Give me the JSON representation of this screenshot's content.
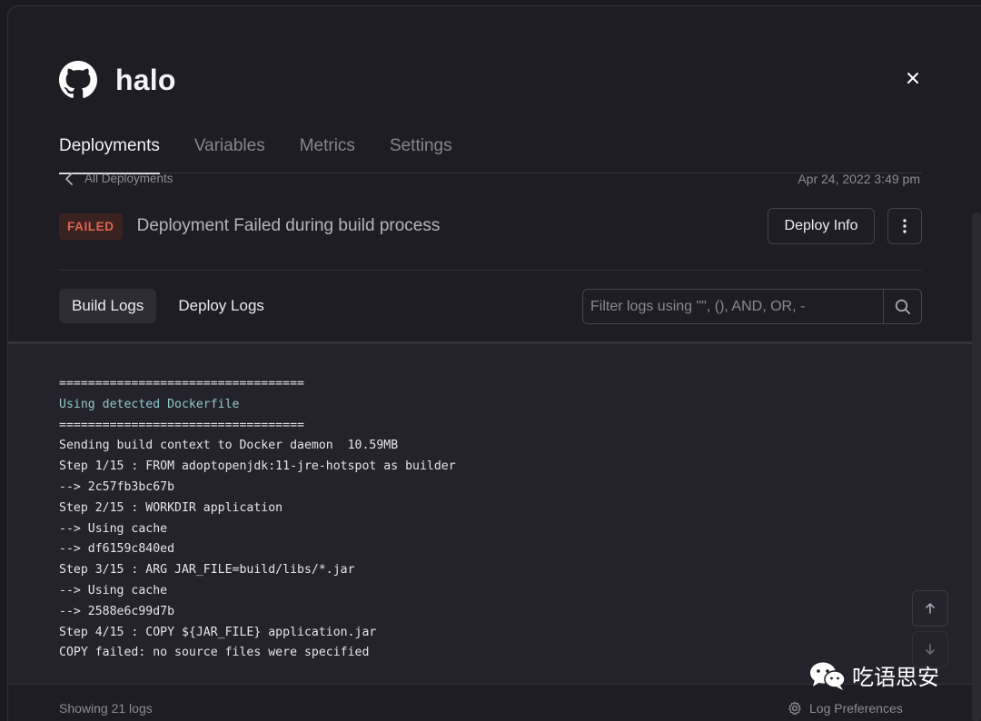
{
  "header": {
    "title": "halo",
    "icon": "github-icon"
  },
  "tabs": [
    {
      "label": "Deployments",
      "active": true
    },
    {
      "label": "Variables",
      "active": false
    },
    {
      "label": "Metrics",
      "active": false
    },
    {
      "label": "Settings",
      "active": false
    }
  ],
  "breadcrumb": {
    "label": "All Deployments"
  },
  "deployment": {
    "date": "Apr 24, 2022 3:49 pm",
    "status": "FAILED",
    "status_color": "#e0654f",
    "message": "Deployment Failed during build process",
    "deploy_info_label": "Deploy Info"
  },
  "log_tabs": [
    {
      "label": "Build Logs",
      "active": true
    },
    {
      "label": "Deploy Logs",
      "active": false
    }
  ],
  "filter": {
    "placeholder": "Filter logs using \"\", (), AND, OR, -"
  },
  "logs": [
    {
      "text": "==================================",
      "highlight": false
    },
    {
      "text": "Using detected Dockerfile",
      "highlight": true
    },
    {
      "text": "==================================",
      "highlight": false
    },
    {
      "text": "Sending build context to Docker daemon  10.59MB",
      "highlight": false
    },
    {
      "text": "Step 1/15 : FROM adoptopenjdk:11-jre-hotspot as builder",
      "highlight": false
    },
    {
      "text": "--> 2c57fb3bc67b",
      "highlight": false
    },
    {
      "text": "Step 2/15 : WORKDIR application",
      "highlight": false
    },
    {
      "text": "--> Using cache",
      "highlight": false
    },
    {
      "text": "--> df6159c840ed",
      "highlight": false
    },
    {
      "text": "Step 3/15 : ARG JAR_FILE=build/libs/*.jar",
      "highlight": false
    },
    {
      "text": "--> Using cache",
      "highlight": false
    },
    {
      "text": "--> 2588e6c99d7b",
      "highlight": false
    },
    {
      "text": "Step 4/15 : COPY ${JAR_FILE} application.jar",
      "highlight": false
    },
    {
      "text": "COPY failed: no source files were specified",
      "highlight": false
    }
  ],
  "footer": {
    "count_label": "Showing 21 logs",
    "prefs_label": "Log Preferences"
  },
  "watermark": {
    "text": "吃语思安"
  }
}
